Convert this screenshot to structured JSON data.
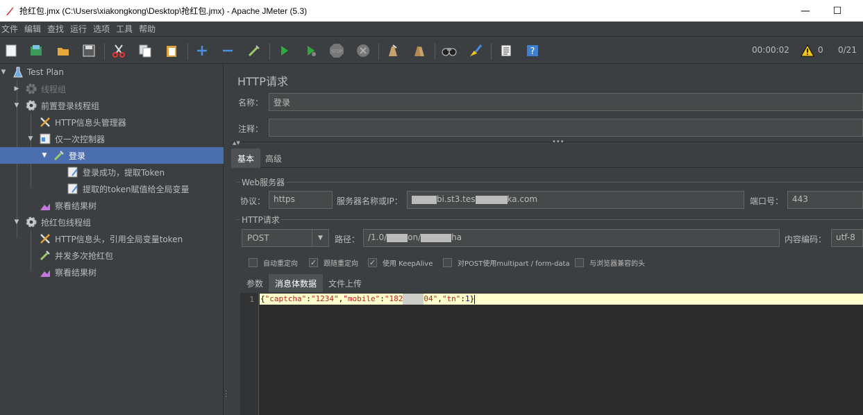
{
  "window": {
    "title": "抢红包.jmx (C:\\Users\\xiakongkong\\Desktop\\抢红包.jmx) - Apache JMeter (5.3)",
    "minimize": "—",
    "maximize": "☐"
  },
  "menu": [
    "文件",
    "编辑",
    "查找",
    "运行",
    "选项",
    "工具",
    "帮助"
  ],
  "toolbar": {
    "icons": [
      "new-icon",
      "templates-icon",
      "open-icon",
      "save-icon",
      "cut-icon",
      "copy-icon",
      "paste-icon",
      "expand-icon",
      "collapse-icon",
      "toggle-icon",
      "start-icon",
      "start-no-pause-icon",
      "stop-icon",
      "shutdown-icon",
      "clear-icon",
      "clear-all-icon",
      "search-icon",
      "reset-search-icon",
      "function-helper-icon",
      "help-icon"
    ],
    "elapsed": "00:00:02",
    "warnings": "0",
    "threads": "0/21",
    "stop_label": "STOP"
  },
  "tree": {
    "items": [
      {
        "label": "Test Plan",
        "icon": "test-plan-icon"
      },
      {
        "label": "线程组",
        "icon": "gear-icon"
      },
      {
        "label": "前置登录线程组",
        "icon": "gear-icon"
      },
      {
        "label": "HTTP信息头管理器",
        "icon": "wrench-icon"
      },
      {
        "label": "仅一次控制器",
        "icon": "controller-icon"
      },
      {
        "label": "登录",
        "icon": "pipette-icon"
      },
      {
        "label": "登录成功，提取Token",
        "icon": "extractor-icon"
      },
      {
        "label": "提取的token赋值给全局变量",
        "icon": "extractor-icon"
      },
      {
        "label": "察看结果树",
        "icon": "chart-icon"
      },
      {
        "label": "抢红包线程组",
        "icon": "gear-icon"
      },
      {
        "label": "HTTP信息头，引用全局变量token",
        "icon": "wrench-icon"
      },
      {
        "label": "并发多次抢红包",
        "icon": "pipette-icon"
      },
      {
        "label": "察看结果树",
        "icon": "chart-icon"
      }
    ]
  },
  "sampler": {
    "title": "HTTP请求",
    "name_label": "名称：",
    "name_value": "登录",
    "comment_label": "注释：",
    "comment_value": "",
    "tabs": [
      "基本",
      "高级"
    ],
    "web_server_group": "Web服务器",
    "protocol_label": "协议：",
    "protocol_value": "https",
    "server_label": "服务器名称或IP：",
    "server_value_a": "bi.st3.tes",
    "server_value_b": "ka.com",
    "port_label": "端口号：",
    "port_value": "443",
    "http_group": "HTTP请求",
    "method_value": "POST",
    "path_label": "路径：",
    "path_value_a": "/1.0/",
    "path_value_b": "on/",
    "path_value_c": "ha",
    "encoding_label": "内容编码：",
    "encoding_value": "utf-8",
    "checkboxes": [
      {
        "label": "自动重定向",
        "checked": false
      },
      {
        "label": "跟随重定向",
        "checked": true
      },
      {
        "label": "使用 KeepAlive",
        "checked": true
      },
      {
        "label": "对POST使用multipart / form-data",
        "checked": false
      },
      {
        "label": "与浏览器兼容的头",
        "checked": false
      }
    ],
    "subtabs": [
      "参数",
      "消息体数据",
      "文件上传"
    ],
    "body": {
      "line_no": "1",
      "t1": "{",
      "t2": "\"captcha\"",
      "t3": ":",
      "t4": "\"1234\"",
      "t5": ",",
      "t6": "\"mobile\"",
      "t7": ":",
      "t8": "\"182",
      "t9": "04\"",
      "t10": ",",
      "t11": "\"tn\"",
      "t12": ":",
      "t13": "1",
      "t14": "}"
    }
  }
}
